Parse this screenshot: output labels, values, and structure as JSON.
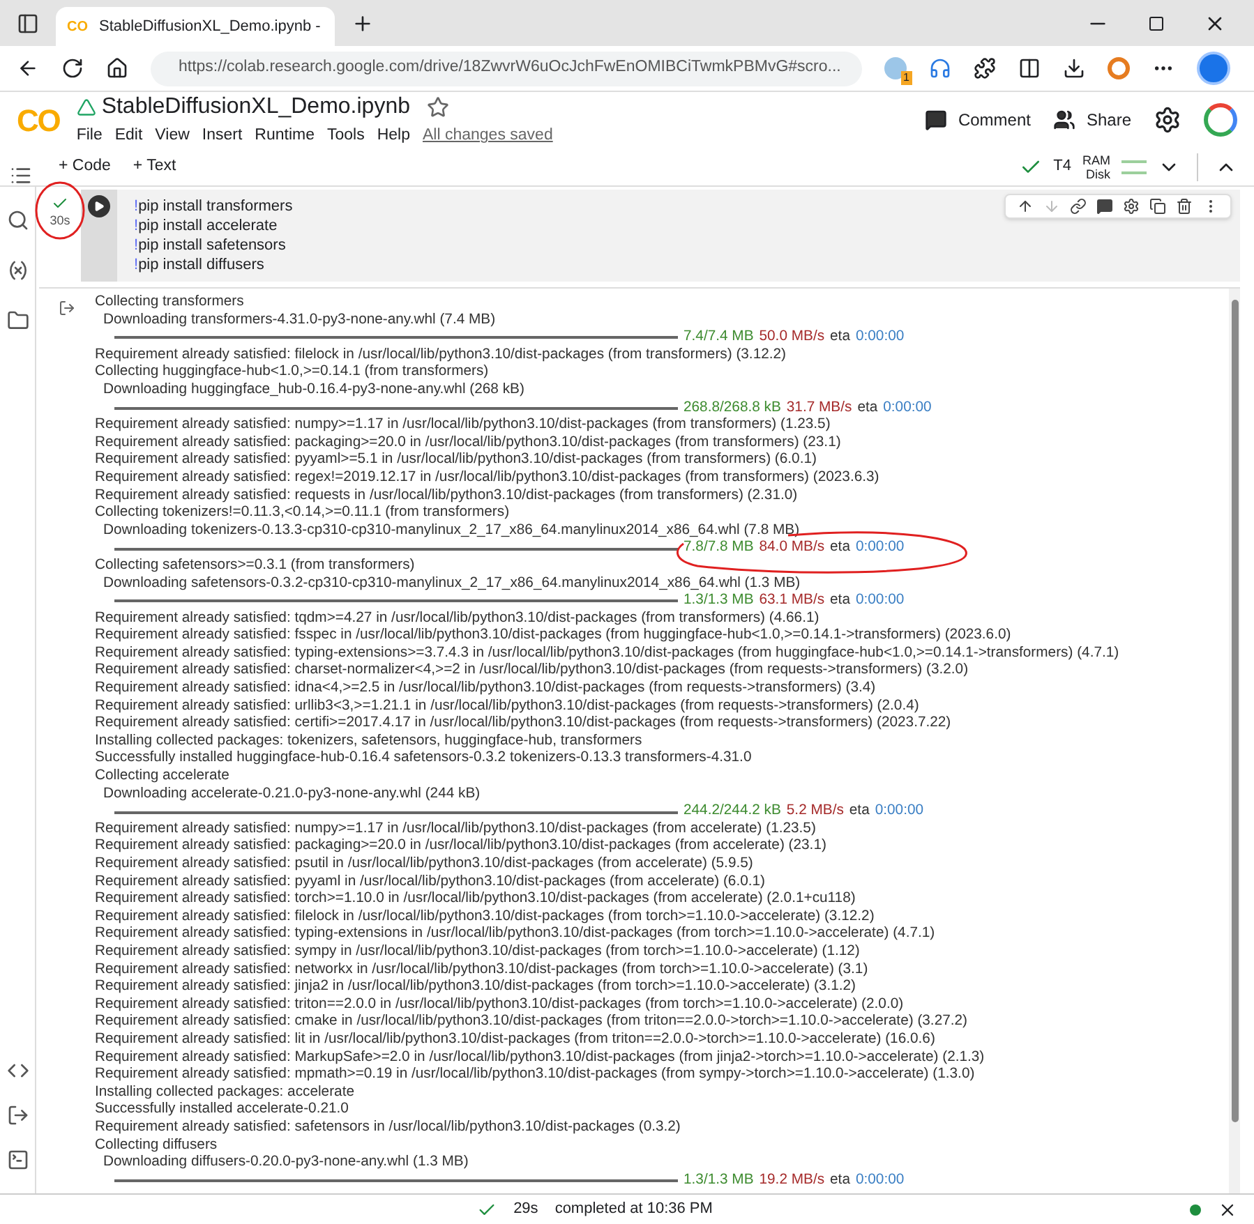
{
  "browser": {
    "tab_logo": "CO",
    "tab_title": "StableDiffusionXL_Demo.ipynb -",
    "url": "https://colab.research.google.com/drive/18ZwvrW6uOcJchFwEnOMIBCiTwmkPBMvG#scro...",
    "extension_badge": "1"
  },
  "notebook": {
    "logo": "CO",
    "title": "StableDiffusionXL_Demo.ipynb",
    "menu": [
      "File",
      "Edit",
      "View",
      "Insert",
      "Runtime",
      "Tools",
      "Help"
    ],
    "save_status": "All changes saved",
    "comment": "Comment",
    "share": "Share"
  },
  "toolbar": {
    "add_code": "+ Code",
    "add_text": "+ Text",
    "runtime": "T4",
    "ram": "RAM",
    "disk": "Disk"
  },
  "cell": {
    "run_time": "30s",
    "code": [
      {
        "bang": "!",
        "command": "pip install transformers"
      },
      {
        "bang": "!",
        "command": "pip install accelerate"
      },
      {
        "bang": "!",
        "command": "pip install safetensors"
      },
      {
        "bang": "!",
        "command": "pip install diffusers"
      }
    ],
    "output": [
      {
        "kind": "text",
        "text": "Collecting transformers"
      },
      {
        "kind": "download",
        "text": "Downloading transformers-4.31.0-py3-none-any.whl (7.4 MB)"
      },
      {
        "kind": "progress",
        "level": 1,
        "amount": "7.4/7.4 MB",
        "speed": "50.0 MB/s",
        "eta_label": "eta",
        "eta": "0:00:00"
      },
      {
        "kind": "text",
        "text": "Requirement already satisfied: filelock in /usr/local/lib/python3.10/dist-packages (from transformers) (3.12.2)"
      },
      {
        "kind": "text",
        "text": "Collecting huggingface-hub<1.0,>=0.14.1 (from transformers)"
      },
      {
        "kind": "download",
        "text": "Downloading huggingface_hub-0.16.4-py3-none-any.whl (268 kB)"
      },
      {
        "kind": "progress",
        "level": 1,
        "amount": "268.8/268.8 kB",
        "speed": "31.7 MB/s",
        "eta_label": "eta",
        "eta": "0:00:00"
      },
      {
        "kind": "text",
        "text": "Requirement already satisfied: numpy>=1.17 in /usr/local/lib/python3.10/dist-packages (from transformers) (1.23.5)"
      },
      {
        "kind": "text",
        "text": "Requirement already satisfied: packaging>=20.0 in /usr/local/lib/python3.10/dist-packages (from transformers) (23.1)"
      },
      {
        "kind": "text",
        "text": "Requirement already satisfied: pyyaml>=5.1 in /usr/local/lib/python3.10/dist-packages (from transformers) (6.0.1)"
      },
      {
        "kind": "text",
        "text": "Requirement already satisfied: regex!=2019.12.17 in /usr/local/lib/python3.10/dist-packages (from transformers) (2023.6.3)"
      },
      {
        "kind": "text",
        "text": "Requirement already satisfied: requests in /usr/local/lib/python3.10/dist-packages (from transformers) (2.31.0)"
      },
      {
        "kind": "text",
        "text": "Collecting tokenizers!=0.11.3,<0.14,>=0.11.1 (from transformers)"
      },
      {
        "kind": "download",
        "text": "Downloading tokenizers-0.13.3-cp310-cp310-manylinux_2_17_x86_64.manylinux2014_x86_64.whl (7.8 MB)"
      },
      {
        "kind": "progress",
        "level": 1,
        "amount": "7.8/7.8 MB",
        "speed": "84.0 MB/s",
        "eta_label": "eta",
        "eta": "0:00:00"
      },
      {
        "kind": "text",
        "text": "Collecting safetensors>=0.3.1 (from transformers)"
      },
      {
        "kind": "download",
        "text": "Downloading safetensors-0.3.2-cp310-cp310-manylinux_2_17_x86_64.manylinux2014_x86_64.whl (1.3 MB)"
      },
      {
        "kind": "progress",
        "level": 1,
        "amount": "1.3/1.3 MB",
        "speed": "63.1 MB/s",
        "eta_label": "eta",
        "eta": "0:00:00"
      },
      {
        "kind": "text",
        "text": "Requirement already satisfied: tqdm>=4.27 in /usr/local/lib/python3.10/dist-packages (from transformers) (4.66.1)"
      },
      {
        "kind": "text",
        "text": "Requirement already satisfied: fsspec in /usr/local/lib/python3.10/dist-packages (from huggingface-hub<1.0,>=0.14.1->transformers) (2023.6.0)"
      },
      {
        "kind": "text",
        "text": "Requirement already satisfied: typing-extensions>=3.7.4.3 in /usr/local/lib/python3.10/dist-packages (from huggingface-hub<1.0,>=0.14.1->transformers) (4.7.1)"
      },
      {
        "kind": "text",
        "text": "Requirement already satisfied: charset-normalizer<4,>=2 in /usr/local/lib/python3.10/dist-packages (from requests->transformers) (3.2.0)"
      },
      {
        "kind": "text",
        "text": "Requirement already satisfied: idna<4,>=2.5 in /usr/local/lib/python3.10/dist-packages (from requests->transformers) (3.4)"
      },
      {
        "kind": "text",
        "text": "Requirement already satisfied: urllib3<3,>=1.21.1 in /usr/local/lib/python3.10/dist-packages (from requests->transformers) (2.0.4)"
      },
      {
        "kind": "text",
        "text": "Requirement already satisfied: certifi>=2017.4.17 in /usr/local/lib/python3.10/dist-packages (from requests->transformers) (2023.7.22)"
      },
      {
        "kind": "text",
        "text": "Installing collected packages: tokenizers, safetensors, huggingface-hub, transformers"
      },
      {
        "kind": "text",
        "text": "Successfully installed huggingface-hub-0.16.4 safetensors-0.3.2 tokenizers-0.13.3 transformers-4.31.0"
      },
      {
        "kind": "text",
        "text": "Collecting accelerate"
      },
      {
        "kind": "download",
        "text": "Downloading accelerate-0.21.0-py3-none-any.whl (244 kB)"
      },
      {
        "kind": "progress",
        "level": 1,
        "amount": "244.2/244.2 kB",
        "speed": "5.2 MB/s",
        "eta_label": "eta",
        "eta": "0:00:00"
      },
      {
        "kind": "text",
        "text": "Requirement already satisfied: numpy>=1.17 in /usr/local/lib/python3.10/dist-packages (from accelerate) (1.23.5)"
      },
      {
        "kind": "text",
        "text": "Requirement already satisfied: packaging>=20.0 in /usr/local/lib/python3.10/dist-packages (from accelerate) (23.1)"
      },
      {
        "kind": "text",
        "text": "Requirement already satisfied: psutil in /usr/local/lib/python3.10/dist-packages (from accelerate) (5.9.5)"
      },
      {
        "kind": "text",
        "text": "Requirement already satisfied: pyyaml in /usr/local/lib/python3.10/dist-packages (from accelerate) (6.0.1)"
      },
      {
        "kind": "text",
        "text": "Requirement already satisfied: torch>=1.10.0 in /usr/local/lib/python3.10/dist-packages (from accelerate) (2.0.1+cu118)"
      },
      {
        "kind": "text",
        "text": "Requirement already satisfied: filelock in /usr/local/lib/python3.10/dist-packages (from torch>=1.10.0->accelerate) (3.12.2)"
      },
      {
        "kind": "text",
        "text": "Requirement already satisfied: typing-extensions in /usr/local/lib/python3.10/dist-packages (from torch>=1.10.0->accelerate) (4.7.1)"
      },
      {
        "kind": "text",
        "text": "Requirement already satisfied: sympy in /usr/local/lib/python3.10/dist-packages (from torch>=1.10.0->accelerate) (1.12)"
      },
      {
        "kind": "text",
        "text": "Requirement already satisfied: networkx in /usr/local/lib/python3.10/dist-packages (from torch>=1.10.0->accelerate) (3.1)"
      },
      {
        "kind": "text",
        "text": "Requirement already satisfied: jinja2 in /usr/local/lib/python3.10/dist-packages (from torch>=1.10.0->accelerate) (3.1.2)"
      },
      {
        "kind": "text",
        "text": "Requirement already satisfied: triton==2.0.0 in /usr/local/lib/python3.10/dist-packages (from torch>=1.10.0->accelerate) (2.0.0)"
      },
      {
        "kind": "text",
        "text": "Requirement already satisfied: cmake in /usr/local/lib/python3.10/dist-packages (from triton==2.0.0->torch>=1.10.0->accelerate) (3.27.2)"
      },
      {
        "kind": "text",
        "text": "Requirement already satisfied: lit in /usr/local/lib/python3.10/dist-packages (from triton==2.0.0->torch>=1.10.0->accelerate) (16.0.6)"
      },
      {
        "kind": "text",
        "text": "Requirement already satisfied: MarkupSafe>=2.0 in /usr/local/lib/python3.10/dist-packages (from jinja2->torch>=1.10.0->accelerate) (2.1.3)"
      },
      {
        "kind": "text",
        "text": "Requirement already satisfied: mpmath>=0.19 in /usr/local/lib/python3.10/dist-packages (from sympy->torch>=1.10.0->accelerate) (1.3.0)"
      },
      {
        "kind": "text",
        "text": "Installing collected packages: accelerate"
      },
      {
        "kind": "text",
        "text": "Successfully installed accelerate-0.21.0"
      },
      {
        "kind": "text",
        "text": "Requirement already satisfied: safetensors in /usr/local/lib/python3.10/dist-packages (0.3.2)"
      },
      {
        "kind": "text",
        "text": "Collecting diffusers"
      },
      {
        "kind": "download",
        "text": "Downloading diffusers-0.20.0-py3-none-any.whl (1.3 MB)"
      },
      {
        "kind": "progress",
        "level": 1,
        "amount": "1.3/1.3 MB",
        "speed": "19.2 MB/s",
        "eta_label": "eta",
        "eta": "0:00:00"
      }
    ]
  },
  "status_bar": {
    "duration": "29s",
    "completed": "completed at 10:36 PM"
  }
}
